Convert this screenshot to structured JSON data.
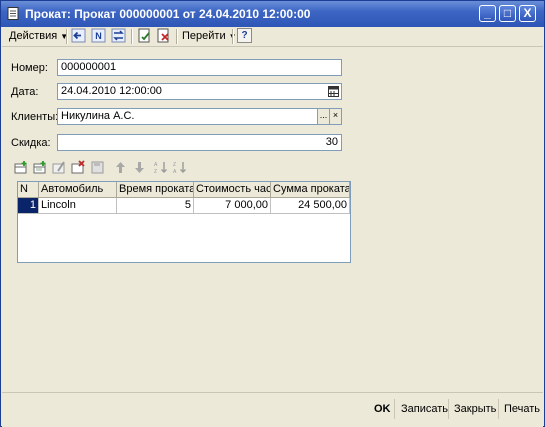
{
  "window": {
    "title": "Прокат: Прокат 000000001 от 24.04.2010 12:00:00",
    "min_symbol": "_",
    "max_symbol": "□",
    "close_symbol": "X"
  },
  "toolbar": {
    "actions_label": "Действия",
    "goto_label": "Перейти",
    "help_symbol": "?"
  },
  "form": {
    "number_label": "Номер:",
    "number_value": "000000001",
    "date_label": "Дата:",
    "date_value": "24.04.2010 12:00:00",
    "clients_label": "Клиенты:",
    "clients_value": "Никулина А.С.",
    "clients_select_symbol": "...",
    "clients_clear_symbol": "×",
    "discount_label": "Скидка:",
    "discount_value": "30"
  },
  "table": {
    "columns": [
      "N",
      "Автомобиль",
      "Время проката",
      "Стоимость часа",
      "Сумма проката"
    ],
    "rows": [
      {
        "n": "1",
        "car": "Lincoln",
        "time": "5",
        "price": "7 000,00",
        "sum": "24 500,00"
      }
    ]
  },
  "footer": {
    "ok_label": "OK",
    "save_label": "Записать",
    "close_label": "Закрыть",
    "print_label": "Печать"
  },
  "colors": {
    "title_bar": "#2e56b6",
    "selection": "#0a246a",
    "window_bg": "#ece9d8"
  }
}
